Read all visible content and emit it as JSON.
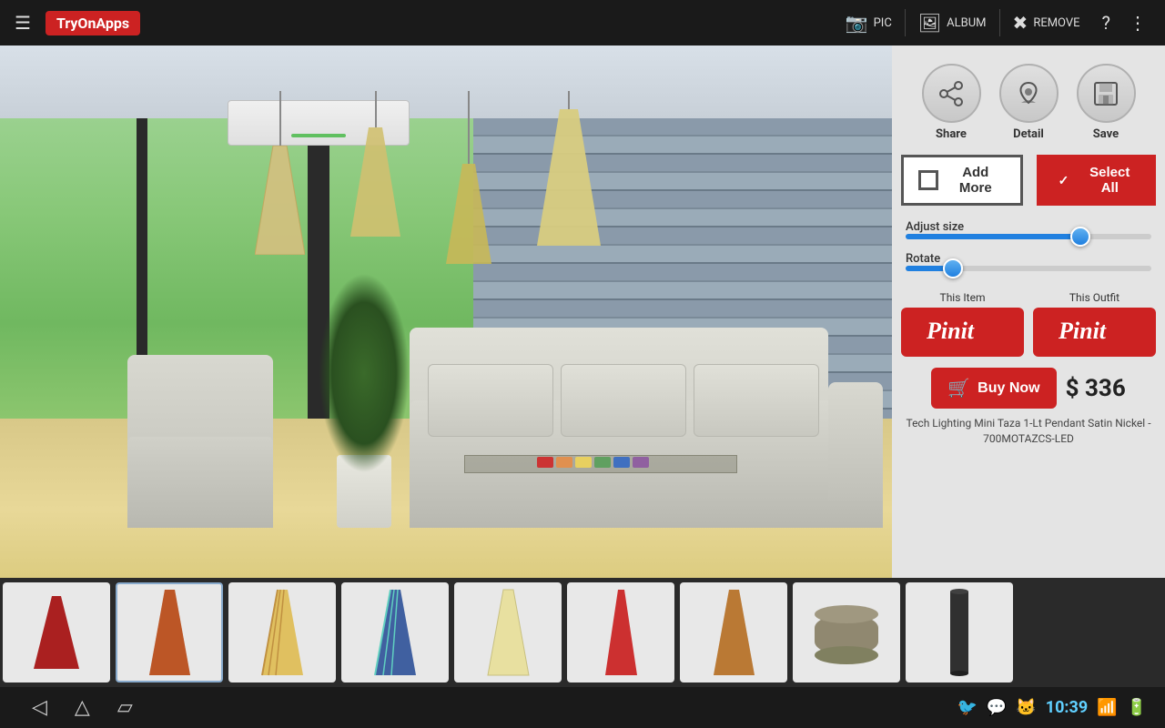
{
  "app": {
    "title": "TryOnApps",
    "logo_color": "#cc2222"
  },
  "topbar": {
    "pic_label": "PIC",
    "album_label": "ALBUM",
    "remove_label": "REMOVE"
  },
  "panel": {
    "share_label": "Share",
    "detail_label": "Detail",
    "save_label": "Save",
    "add_more_label": "Add More",
    "select_all_label": "Select All",
    "adjust_size_label": "Adjust size",
    "rotate_label": "Rotate",
    "this_item_label": "This Item",
    "this_outfit_label": "This Outfit",
    "pinit_label": "Pinit",
    "buy_now_label": "Buy Now",
    "price": "$ 336",
    "product_name": "Tech Lighting Mini Taza 1-Lt Pendant Satin Nickel - 700MOTAZCS-LED"
  },
  "thumbnails": [
    {
      "id": 1,
      "color": "#cc2222",
      "shape": "cone",
      "label": "lamp1"
    },
    {
      "id": 2,
      "color": "#b05020",
      "shape": "tall-cone",
      "label": "lamp2"
    },
    {
      "id": 3,
      "color": "#e0c060",
      "shape": "tall-cone",
      "label": "lamp3"
    },
    {
      "id": 4,
      "color": "#4060a0",
      "shape": "tall-cone",
      "label": "lamp4"
    },
    {
      "id": 5,
      "color": "#d4c080",
      "shape": "tall-cone",
      "label": "lamp5"
    },
    {
      "id": 6,
      "color": "#cc3030",
      "shape": "tall-cone",
      "label": "lamp6"
    },
    {
      "id": 7,
      "color": "#b07030",
      "shape": "tall-cone",
      "label": "lamp7"
    },
    {
      "id": 8,
      "color": "#808070",
      "shape": "drum",
      "label": "lamp8"
    },
    {
      "id": 9,
      "color": "#303030",
      "shape": "cylinder",
      "label": "lamp9"
    }
  ],
  "bottomnav": {
    "back_icon": "◁",
    "home_icon": "△",
    "recent_icon": "▱",
    "twitter_icon": "🐦",
    "chat_icon": "💬",
    "other_icon": "🐱",
    "time": "10:39",
    "wifi_icon": "📶",
    "battery_icon": "🔋"
  }
}
